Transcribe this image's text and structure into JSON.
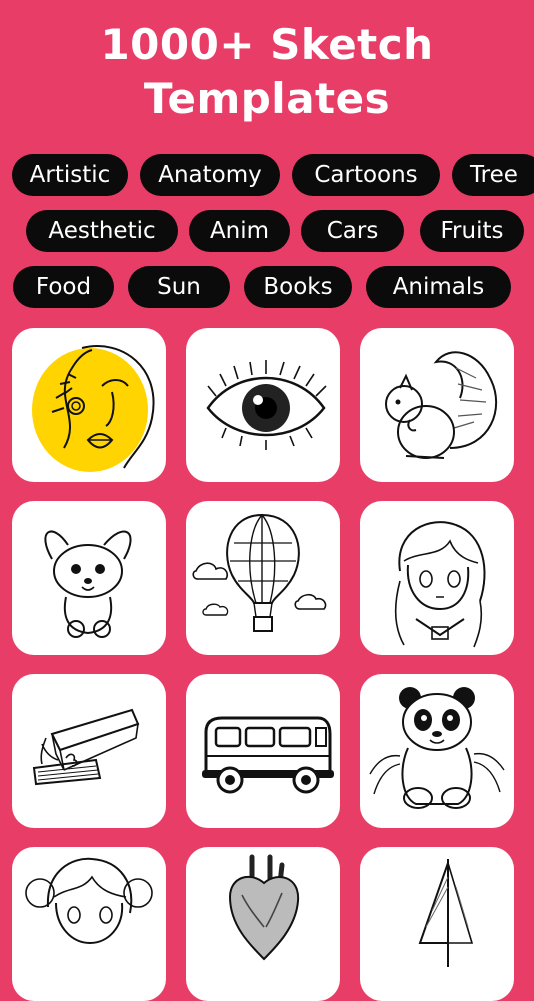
{
  "header": {
    "title_line1": "1000+ Sketch",
    "title_line2": "Templates"
  },
  "categories": {
    "row1": [
      "Artistic",
      "Anatomy",
      "Cartoons",
      "Tree"
    ],
    "row2": [
      "Aesthetic",
      "Anim",
      "Cars",
      "Fruits"
    ],
    "row3": [
      "Food",
      "Sun",
      "Books",
      "Animals"
    ]
  },
  "templates": [
    {
      "icon": "line-art-face-icon"
    },
    {
      "icon": "eye-sketch-icon"
    },
    {
      "icon": "squirrel-sketch-icon"
    },
    {
      "icon": "bunny-cartoon-icon"
    },
    {
      "icon": "hot-air-balloon-icon"
    },
    {
      "icon": "anime-girl-icon"
    },
    {
      "icon": "book-sketch-icon"
    },
    {
      "icon": "van-sketch-icon"
    },
    {
      "icon": "panda-sketch-icon"
    },
    {
      "icon": "anime-girl-portrait-icon"
    },
    {
      "icon": "heart-anatomy-icon"
    },
    {
      "icon": "sailboat-sketch-icon"
    }
  ],
  "colors": {
    "background": "#E83D67",
    "chip": "#0b0b0b",
    "accent_yellow": "#FFD400"
  }
}
